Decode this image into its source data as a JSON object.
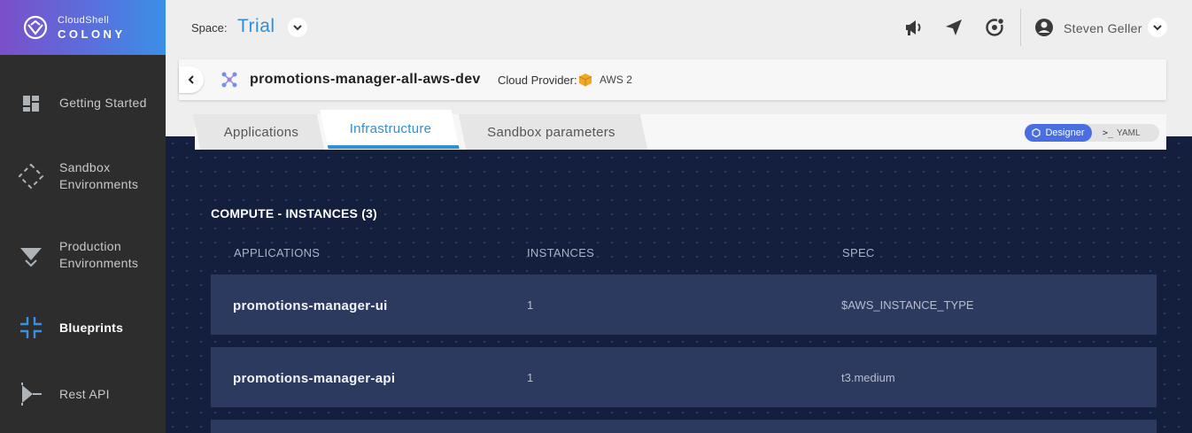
{
  "brand": {
    "top": "CloudShell",
    "bottom": "COLONY"
  },
  "sidebar": {
    "items": [
      {
        "label": "Getting Started",
        "icon": "dashboard-icon",
        "active": false
      },
      {
        "label": "Sandbox Environments",
        "icon": "sandbox-icon",
        "active": false
      },
      {
        "label": "Production Environments",
        "icon": "production-icon",
        "active": false
      },
      {
        "label": "Blueprints",
        "icon": "blueprints-icon",
        "active": true
      },
      {
        "label": "Rest API",
        "icon": "rest-api-icon",
        "active": false
      }
    ]
  },
  "topbar": {
    "space_label": "Space:",
    "space_value": "Trial",
    "user_name": "Steven Geller",
    "icons": [
      "megaphone-icon",
      "send-icon",
      "notifications-icon",
      "user-icon"
    ]
  },
  "blueprint": {
    "name": "promotions-manager-all-aws-dev",
    "cloud_provider_label": "Cloud Provider:",
    "cloud_provider_value": "AWS 2"
  },
  "tabs": [
    {
      "label": "Applications",
      "active": false
    },
    {
      "label": "Infrastructure",
      "active": true
    },
    {
      "label": "Sandbox parameters",
      "active": false
    }
  ],
  "mode": {
    "designer": "Designer",
    "yaml": "YAML",
    "selected": "Designer"
  },
  "compute": {
    "title": "COMPUTE - INSTANCES (3)",
    "columns": [
      "APPLICATIONS",
      "INSTANCES",
      "SPEC"
    ],
    "rows": [
      {
        "app": "promotions-manager-ui",
        "instances": "1",
        "spec": "$AWS_INSTANCE_TYPE"
      },
      {
        "app": "promotions-manager-api",
        "instances": "1",
        "spec": "t3.medium"
      }
    ]
  },
  "colors": {
    "accent": "#2f8fd8",
    "sidebar": "#2d2d2d",
    "content_bg": "#141e3d",
    "row_bg": "#2c3a5f",
    "designer_pill": "#4a6ee0"
  }
}
